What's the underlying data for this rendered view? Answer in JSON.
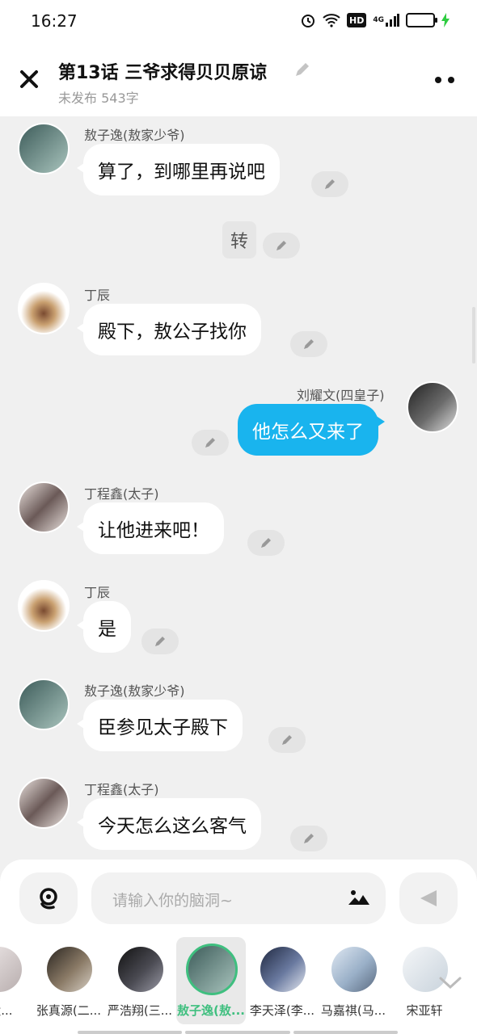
{
  "status_bar": {
    "time": "16:27",
    "hd": "HD",
    "net": "4G"
  },
  "header": {
    "title": "第13话  三爷求得贝贝原谅",
    "subtitle": "未发布 543字"
  },
  "messages": [
    {
      "side": "left",
      "name": "敖子逸(敖家少爷)",
      "text": "算了，到哪里再说吧",
      "avatar_color": "#5a7f7a"
    },
    {
      "side": "narration",
      "text": "转"
    },
    {
      "side": "left",
      "name": "丁辰",
      "text": "殿下，敖公子找你",
      "avatar_color": "#8a6a4a"
    },
    {
      "side": "right",
      "name": "刘耀文(四皇子)",
      "text": "他怎么又来了",
      "avatar_color": "#4a4a4a"
    },
    {
      "side": "left",
      "name": "丁程鑫(太子)",
      "text": "让他进来吧！",
      "avatar_color": "#9a8a8a"
    },
    {
      "side": "left",
      "name": "丁辰",
      "text": "是",
      "avatar_color": "#8a6a4a"
    },
    {
      "side": "left",
      "name": "敖子逸(敖家少爷)",
      "text": "臣参见太子殿下",
      "avatar_color": "#5a7f7a"
    },
    {
      "side": "left",
      "name": "丁程鑫(太子)",
      "text": "今天怎么这么客气",
      "avatar_color": "#9a8a8a"
    }
  ],
  "composer": {
    "placeholder": "请输入你的脑洞~"
  },
  "roles": [
    {
      "label": "(太...",
      "color": "#b8aeae"
    },
    {
      "label": "张真源(二...",
      "color": "#5d5246"
    },
    {
      "label": "严浩翔(三...",
      "color": "#2f2f35"
    },
    {
      "label": "敖子逸(敖...",
      "color": "#5a7f7a",
      "active": true
    },
    {
      "label": "李天泽(李...",
      "color": "#3a4a6a"
    },
    {
      "label": "马嘉祺(马...",
      "color": "#9ab0c8"
    },
    {
      "label": "宋亚轩",
      "color": "#c9d3dc"
    }
  ],
  "colors": {
    "accent_blue": "#19b4ee",
    "active_green": "#3fbf7f"
  }
}
